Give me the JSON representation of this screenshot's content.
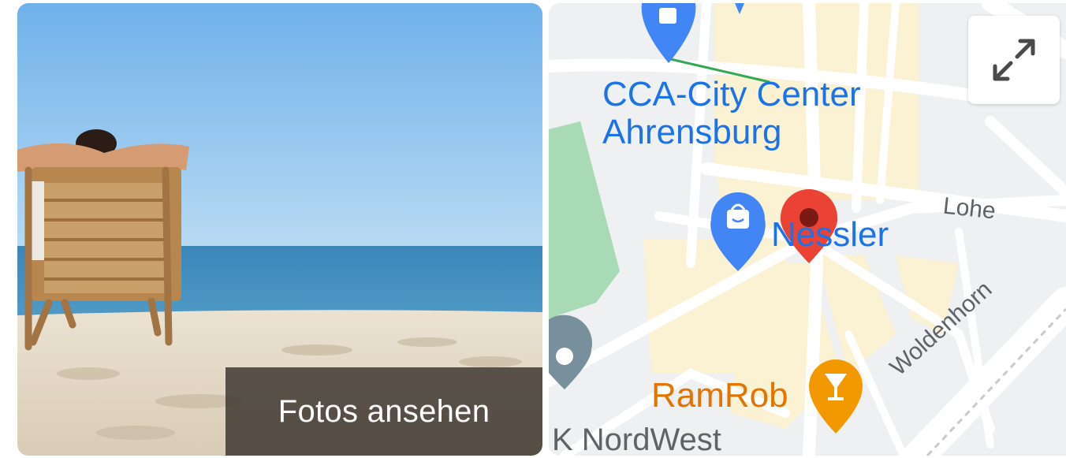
{
  "photo": {
    "overlay_label": "Fotos ansehen"
  },
  "map": {
    "places": [
      {
        "label": "CCA-City Center\nAhrensburg",
        "line1": "CCA-City Center",
        "line2": "Ahrensburg",
        "icon": "shopping-bag-pin"
      },
      {
        "label": "Nessler",
        "icon": "shopping-bag-pin"
      },
      {
        "label": "RamRob",
        "icon": "cocktail-pin"
      },
      {
        "label": "K NordWest",
        "icon": "location-pin"
      }
    ],
    "streets": [
      "Lohe",
      "Woldenhorn"
    ],
    "selected_marker": "red-location-pin",
    "expand_icon": "expand-arrows-icon"
  },
  "colors": {
    "poi_blue": "#1a73e8",
    "poi_orange": "#e37400",
    "marker_red": "#ea4335",
    "park_green": "#a8dab5",
    "block_yellow": "#fbf1d3"
  }
}
